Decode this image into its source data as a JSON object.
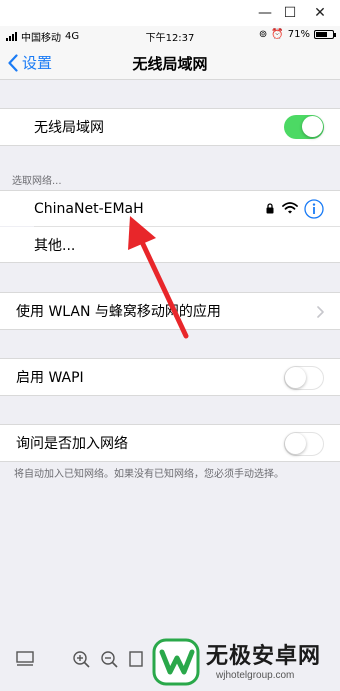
{
  "window": {
    "minimize_glyph": "—",
    "maximize_glyph": "☐",
    "close_glyph": "✕"
  },
  "status_bar": {
    "carrier": "中国移动",
    "network": "4G",
    "time": "下午12:37",
    "battery_percent": "71%",
    "battery_level": 0.71
  },
  "nav": {
    "back_label": "设置",
    "title": "无线局域网"
  },
  "wifi": {
    "label": "无线局域网",
    "enabled": true
  },
  "networks": {
    "header": "选取网络...",
    "current": "ChinaNet-EMaH",
    "other": "其他..."
  },
  "wlan_cellular": {
    "label": "使用 WLAN 与蜂窝移动网的应用"
  },
  "wapi": {
    "label": "启用 WAPI",
    "enabled": false
  },
  "ask_join": {
    "label": "询问是否加入网络",
    "enabled": false,
    "note": "将自动加入已知网络。如果没有已知网络，您必须手动选择。"
  },
  "watermark": {
    "name": "无极安卓网",
    "url": "wjhotelgroup.com"
  },
  "colors": {
    "accent": "#1a7bf5",
    "toggle_on": "#4cd964",
    "arrow": "#e8262a"
  }
}
